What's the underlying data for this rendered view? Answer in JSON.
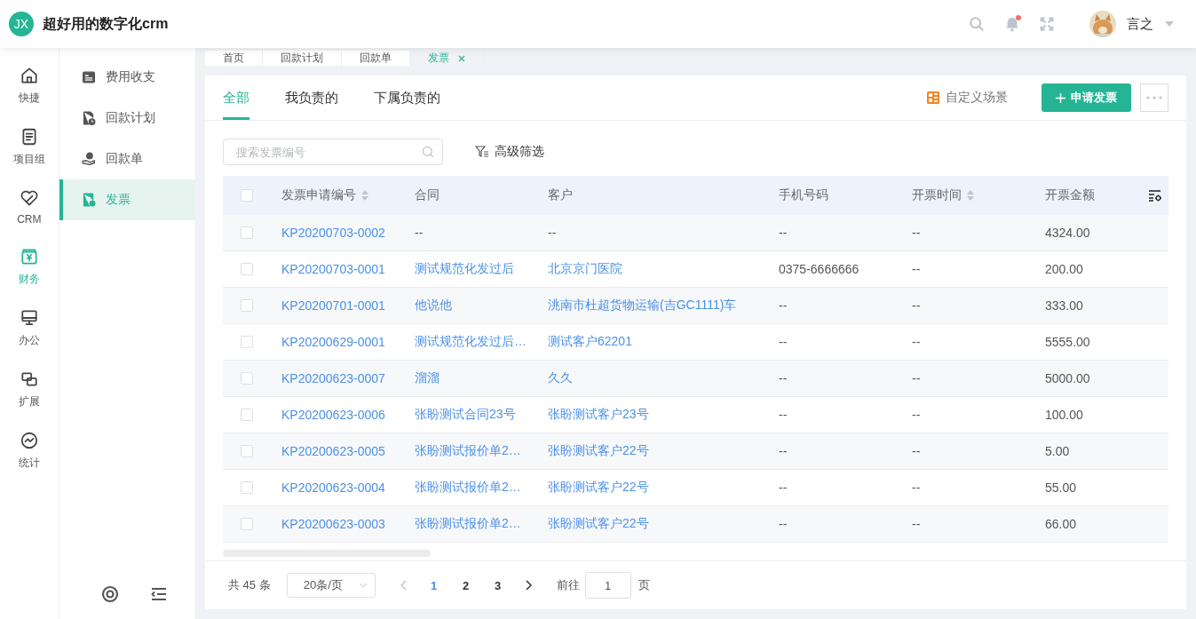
{
  "header": {
    "logo_text": "JX",
    "app_title": "超好用的数字化crm",
    "notification_dot": true,
    "user_name": "言之"
  },
  "nav_rail": [
    {
      "label": "快捷",
      "selected": false
    },
    {
      "label": "项目组",
      "selected": false
    },
    {
      "label": "CRM",
      "selected": false
    },
    {
      "label": "财务",
      "selected": true
    },
    {
      "label": "办公",
      "selected": false
    },
    {
      "label": "扩展",
      "selected": false
    },
    {
      "label": "统计",
      "selected": false
    }
  ],
  "submenu": [
    {
      "label": "费用收支",
      "selected": false
    },
    {
      "label": "回款计划",
      "selected": false
    },
    {
      "label": "回款单",
      "selected": false
    },
    {
      "label": "发票",
      "selected": true
    }
  ],
  "page_tabs": [
    {
      "label": "首页",
      "selected": false,
      "closable": false
    },
    {
      "label": "回款计划",
      "selected": false,
      "closable": false
    },
    {
      "label": "回款单",
      "selected": false,
      "closable": false
    },
    {
      "label": "发票",
      "selected": true,
      "closable": true
    }
  ],
  "scope_tabs": [
    {
      "label": "全部",
      "selected": true
    },
    {
      "label": "我负责的",
      "selected": false
    },
    {
      "label": "下属负责的",
      "selected": false
    }
  ],
  "custom_scene": "自定义场景",
  "primary_button": "申请发票",
  "search": {
    "placeholder": "搜索发票编号"
  },
  "advanced_filter": "高级筛选",
  "table": {
    "select_all_checked": false,
    "columns": [
      {
        "label": "发票申请编号",
        "sortable": true
      },
      {
        "label": "合同",
        "sortable": false
      },
      {
        "label": "客户",
        "sortable": false
      },
      {
        "label": "手机号码",
        "sortable": false
      },
      {
        "label": "开票时间",
        "sortable": true
      },
      {
        "label": "开票金额",
        "sortable": false
      }
    ],
    "rows": [
      {
        "checked": false,
        "cells": [
          {
            "text": "KP20200703-0002",
            "link": true
          },
          {
            "text": "--",
            "link": false
          },
          {
            "text": "--",
            "link": false
          },
          {
            "text": "--",
            "link": false
          },
          {
            "text": "--",
            "link": false
          },
          {
            "text": "4324.00",
            "link": false
          }
        ]
      },
      {
        "checked": false,
        "cells": [
          {
            "text": "KP20200703-0001",
            "link": true
          },
          {
            "text": "测试规范化发过后",
            "link": true
          },
          {
            "text": "北京京门医院",
            "link": true
          },
          {
            "text": "0375-6666666",
            "link": false
          },
          {
            "text": "--",
            "link": false
          },
          {
            "text": "200.00",
            "link": false
          }
        ]
      },
      {
        "checked": false,
        "cells": [
          {
            "text": "KP20200701-0001",
            "link": true
          },
          {
            "text": "他说他",
            "link": true
          },
          {
            "text": "洮南市杜超货物运输(吉GC1111)车",
            "link": true
          },
          {
            "text": "--",
            "link": false
          },
          {
            "text": "--",
            "link": false
          },
          {
            "text": "333.00",
            "link": false
          }
        ]
      },
      {
        "checked": false,
        "cells": [
          {
            "text": "KP20200629-0001",
            "link": true
          },
          {
            "text": "测试规范化发过后…",
            "link": true
          },
          {
            "text": "测试客户62201",
            "link": true
          },
          {
            "text": "--",
            "link": false
          },
          {
            "text": "--",
            "link": false
          },
          {
            "text": "5555.00",
            "link": false
          }
        ]
      },
      {
        "checked": false,
        "cells": [
          {
            "text": "KP20200623-0007",
            "link": true
          },
          {
            "text": "溜溜",
            "link": true
          },
          {
            "text": "久久",
            "link": true
          },
          {
            "text": "--",
            "link": false
          },
          {
            "text": "--",
            "link": false
          },
          {
            "text": "5000.00",
            "link": false
          }
        ]
      },
      {
        "checked": false,
        "cells": [
          {
            "text": "KP20200623-0006",
            "link": true
          },
          {
            "text": "张盼测试合同23号",
            "link": true
          },
          {
            "text": "张盼测试客户23号",
            "link": true
          },
          {
            "text": "--",
            "link": false
          },
          {
            "text": "--",
            "link": false
          },
          {
            "text": "100.00",
            "link": false
          }
        ]
      },
      {
        "checked": false,
        "cells": [
          {
            "text": "KP20200623-0005",
            "link": true
          },
          {
            "text": "张盼测试报价单2…",
            "link": true
          },
          {
            "text": "张盼测试客户22号",
            "link": true
          },
          {
            "text": "--",
            "link": false
          },
          {
            "text": "--",
            "link": false
          },
          {
            "text": "5.00",
            "link": false
          }
        ]
      },
      {
        "checked": false,
        "cells": [
          {
            "text": "KP20200623-0004",
            "link": true
          },
          {
            "text": "张盼测试报价单2…",
            "link": true
          },
          {
            "text": "张盼测试客户22号",
            "link": true
          },
          {
            "text": "--",
            "link": false
          },
          {
            "text": "--",
            "link": false
          },
          {
            "text": "55.00",
            "link": false
          }
        ]
      },
      {
        "checked": false,
        "cells": [
          {
            "text": "KP20200623-0003",
            "link": true
          },
          {
            "text": "张盼测试报价单2…",
            "link": true
          },
          {
            "text": "张盼测试客户22号",
            "link": true
          },
          {
            "text": "--",
            "link": false
          },
          {
            "text": "--",
            "link": false
          },
          {
            "text": "66.00",
            "link": false
          }
        ]
      }
    ]
  },
  "pagination": {
    "total": "共 45 条",
    "page_size": "20条/页",
    "pages": [
      {
        "label": "1",
        "selected": true
      },
      {
        "label": "2",
        "selected": false
      },
      {
        "label": "3",
        "selected": false
      }
    ],
    "goto_label": "前往",
    "goto_value": "1",
    "page_suffix": "页"
  }
}
